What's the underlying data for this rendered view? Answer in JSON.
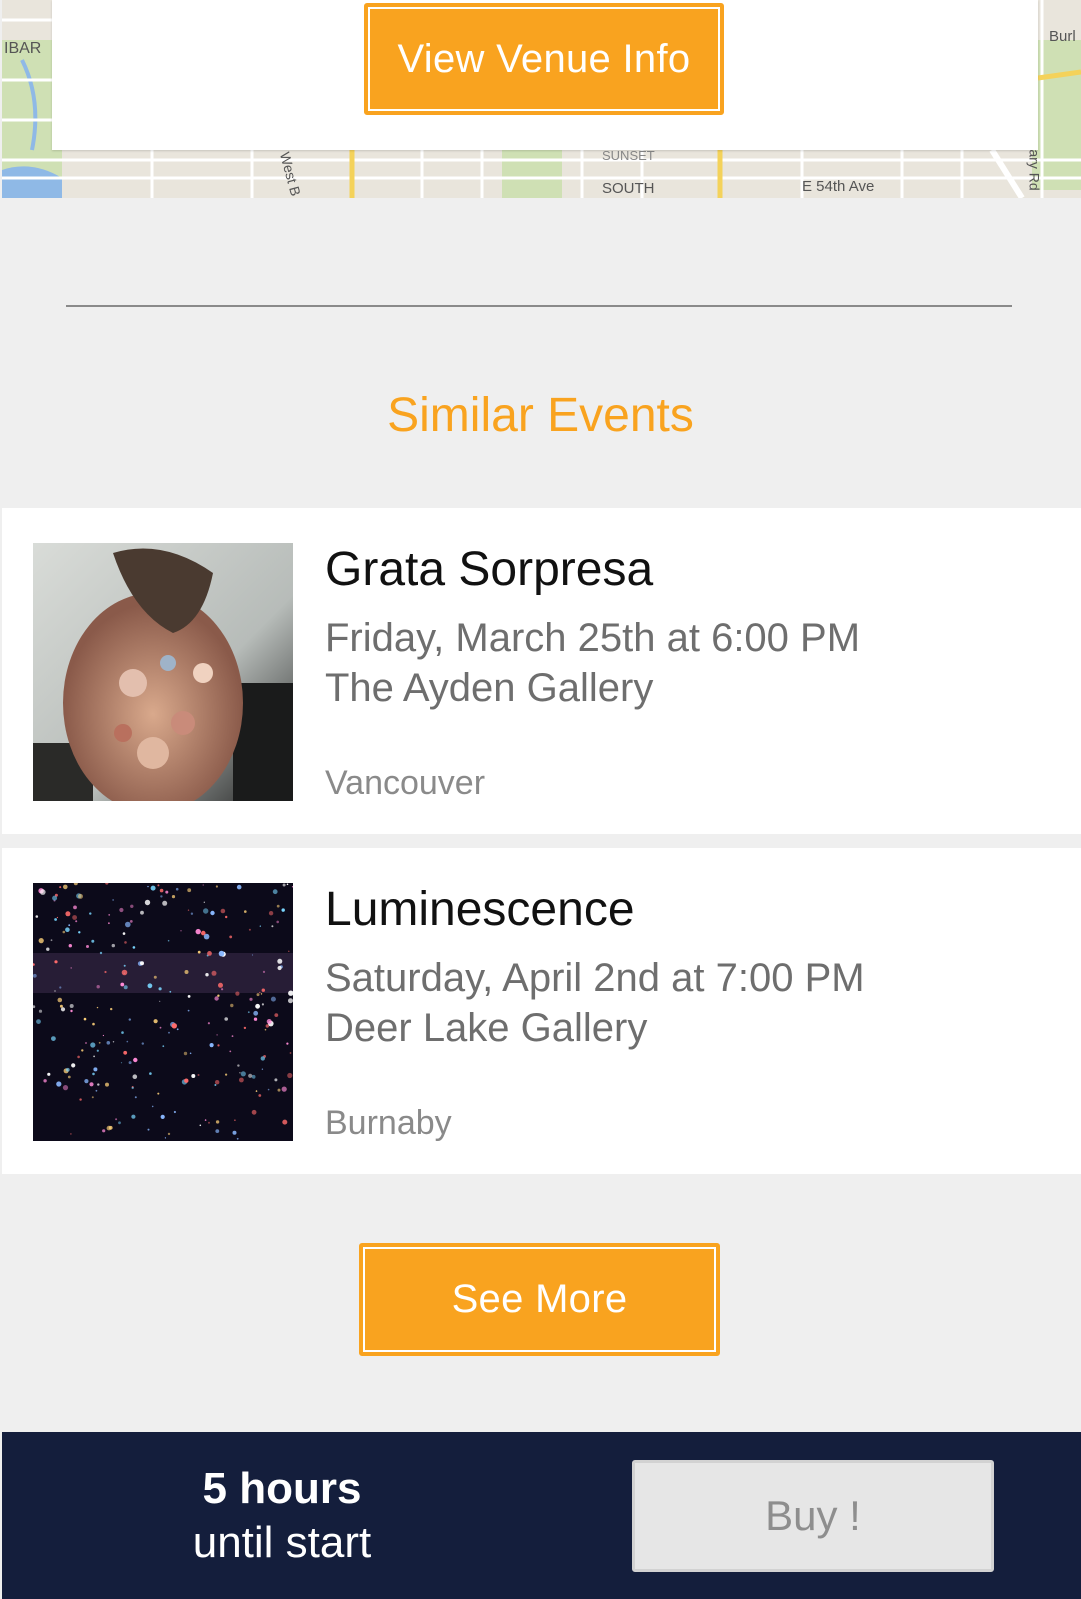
{
  "map": {
    "labels": [
      "IBAR",
      "West B",
      "SOUTH",
      "SUNSET",
      "E 54th Ave",
      "Burl",
      "ary Rd"
    ]
  },
  "venue": {
    "button_label": "View Venue Info"
  },
  "similar": {
    "title": "Similar Events",
    "events": [
      {
        "title": "Grata Sorpresa",
        "date": "Friday, March 25th at 6:00 PM",
        "venue": "The Ayden Gallery",
        "city": "Vancouver"
      },
      {
        "title": "Luminescence",
        "date": "Saturday, April 2nd at 7:00 PM",
        "venue": "Deer Lake Gallery",
        "city": "Burnaby"
      }
    ],
    "see_more_label": "See More"
  },
  "footer": {
    "countdown_value": "5 hours",
    "countdown_suffix": "until start",
    "buy_label": "Buy !"
  },
  "colors": {
    "accent": "#f9a31f",
    "footer_bg": "#141e3c",
    "page_bg": "#efefef"
  }
}
